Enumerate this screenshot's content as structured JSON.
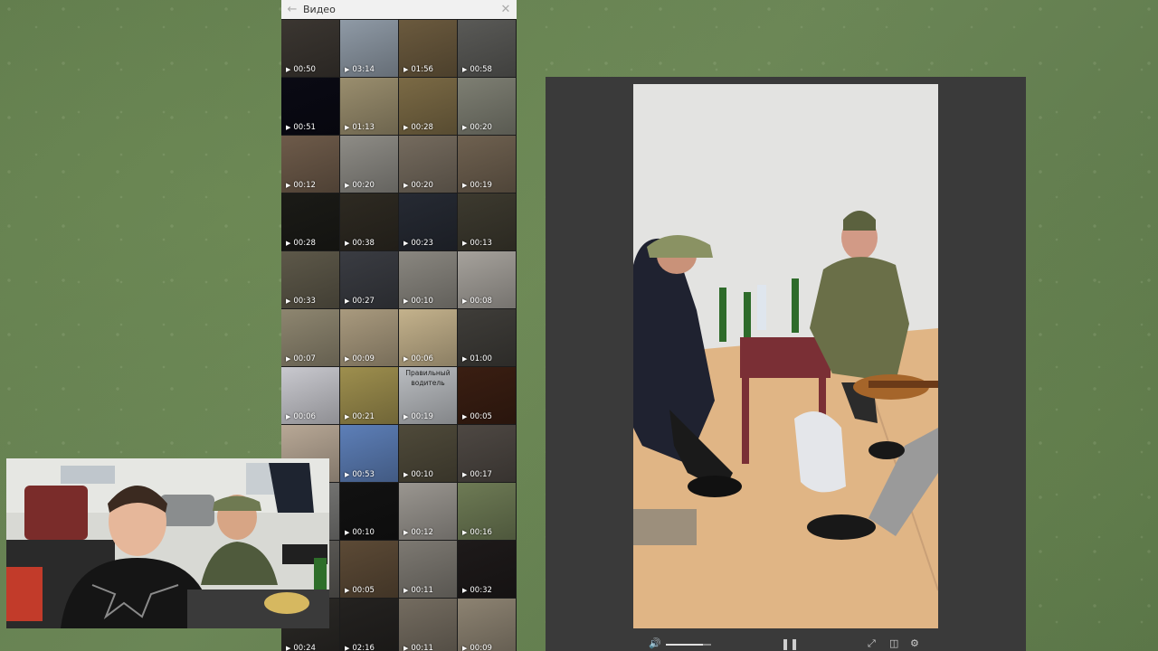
{
  "gallery": {
    "title": "Видео",
    "back_icon": "arrow-left-icon",
    "close_icon": "close-icon",
    "videos": [
      {
        "duration": "00:50",
        "bg": "#3b3631"
      },
      {
        "duration": "03:14",
        "bg": "#8f9aa6"
      },
      {
        "duration": "01:56",
        "bg": "#6b5a3e"
      },
      {
        "duration": "00:58",
        "bg": "#5a5a57"
      },
      {
        "duration": "00:51",
        "bg": "#0a0a14"
      },
      {
        "duration": "01:13",
        "bg": "#9a8e6e"
      },
      {
        "duration": "00:28",
        "bg": "#7b6a45"
      },
      {
        "duration": "00:20",
        "bg": "#7e7f73"
      },
      {
        "duration": "00:12",
        "bg": "#6e5b4a"
      },
      {
        "duration": "00:20",
        "bg": "#8e8c86"
      },
      {
        "duration": "00:20",
        "bg": "#756b5e"
      },
      {
        "duration": "00:19",
        "bg": "#6f6150"
      },
      {
        "duration": "00:28",
        "bg": "#1b1b17"
      },
      {
        "duration": "00:38",
        "bg": "#2e2a22"
      },
      {
        "duration": "00:23",
        "bg": "#262a33"
      },
      {
        "duration": "00:13",
        "bg": "#3d3a2f"
      },
      {
        "duration": "00:33",
        "bg": "#5d5849"
      },
      {
        "duration": "00:27",
        "bg": "#3a3c42"
      },
      {
        "duration": "00:10",
        "bg": "#8a8780"
      },
      {
        "duration": "00:08",
        "bg": "#a6a29c"
      },
      {
        "duration": "00:07",
        "bg": "#8e8670"
      },
      {
        "duration": "00:09",
        "bg": "#a99a7e"
      },
      {
        "duration": "00:06",
        "bg": "#c4b28c"
      },
      {
        "duration": "01:00",
        "bg": "#3f3d39"
      },
      {
        "duration": "00:06",
        "bg": "#c9c9cf"
      },
      {
        "duration": "00:21",
        "bg": "#9e8f4e"
      },
      {
        "duration": "00:19",
        "bg": "#b9bcc0",
        "caption": "Правильный водитель"
      },
      {
        "duration": "00:05",
        "bg": "#3a1e12"
      },
      {
        "duration": "",
        "bg": "#b8a896"
      },
      {
        "duration": "00:53",
        "bg": "#5d7fb8"
      },
      {
        "duration": "00:10",
        "bg": "#4f4a3a"
      },
      {
        "duration": "00:17",
        "bg": "#4e4843"
      },
      {
        "duration": "",
        "bg": "#7a7a78"
      },
      {
        "duration": "00:10",
        "bg": "#121212"
      },
      {
        "duration": "00:12",
        "bg": "#9a9690"
      },
      {
        "duration": "00:16",
        "bg": "#6e7b55"
      },
      {
        "duration": "",
        "bg": "#5e5c58"
      },
      {
        "duration": "00:05",
        "bg": "#5c4a36"
      },
      {
        "duration": "00:11",
        "bg": "#7d7972"
      },
      {
        "duration": "00:32",
        "bg": "#1e1a1a"
      },
      {
        "duration": "00:24",
        "bg": "#2b2926"
      },
      {
        "duration": "02:16",
        "bg": "#242220"
      },
      {
        "duration": "00:11",
        "bg": "#746c60"
      },
      {
        "duration": "00:09",
        "bg": "#8d8372"
      }
    ]
  },
  "player": {
    "volume_icon": "volume-icon",
    "volume_level": 0.82,
    "pause_icon": "pause-icon",
    "fullscreen_icon": "fullscreen-icon",
    "pip_icon": "picture-in-picture-icon",
    "settings_icon": "settings-gear-icon"
  }
}
